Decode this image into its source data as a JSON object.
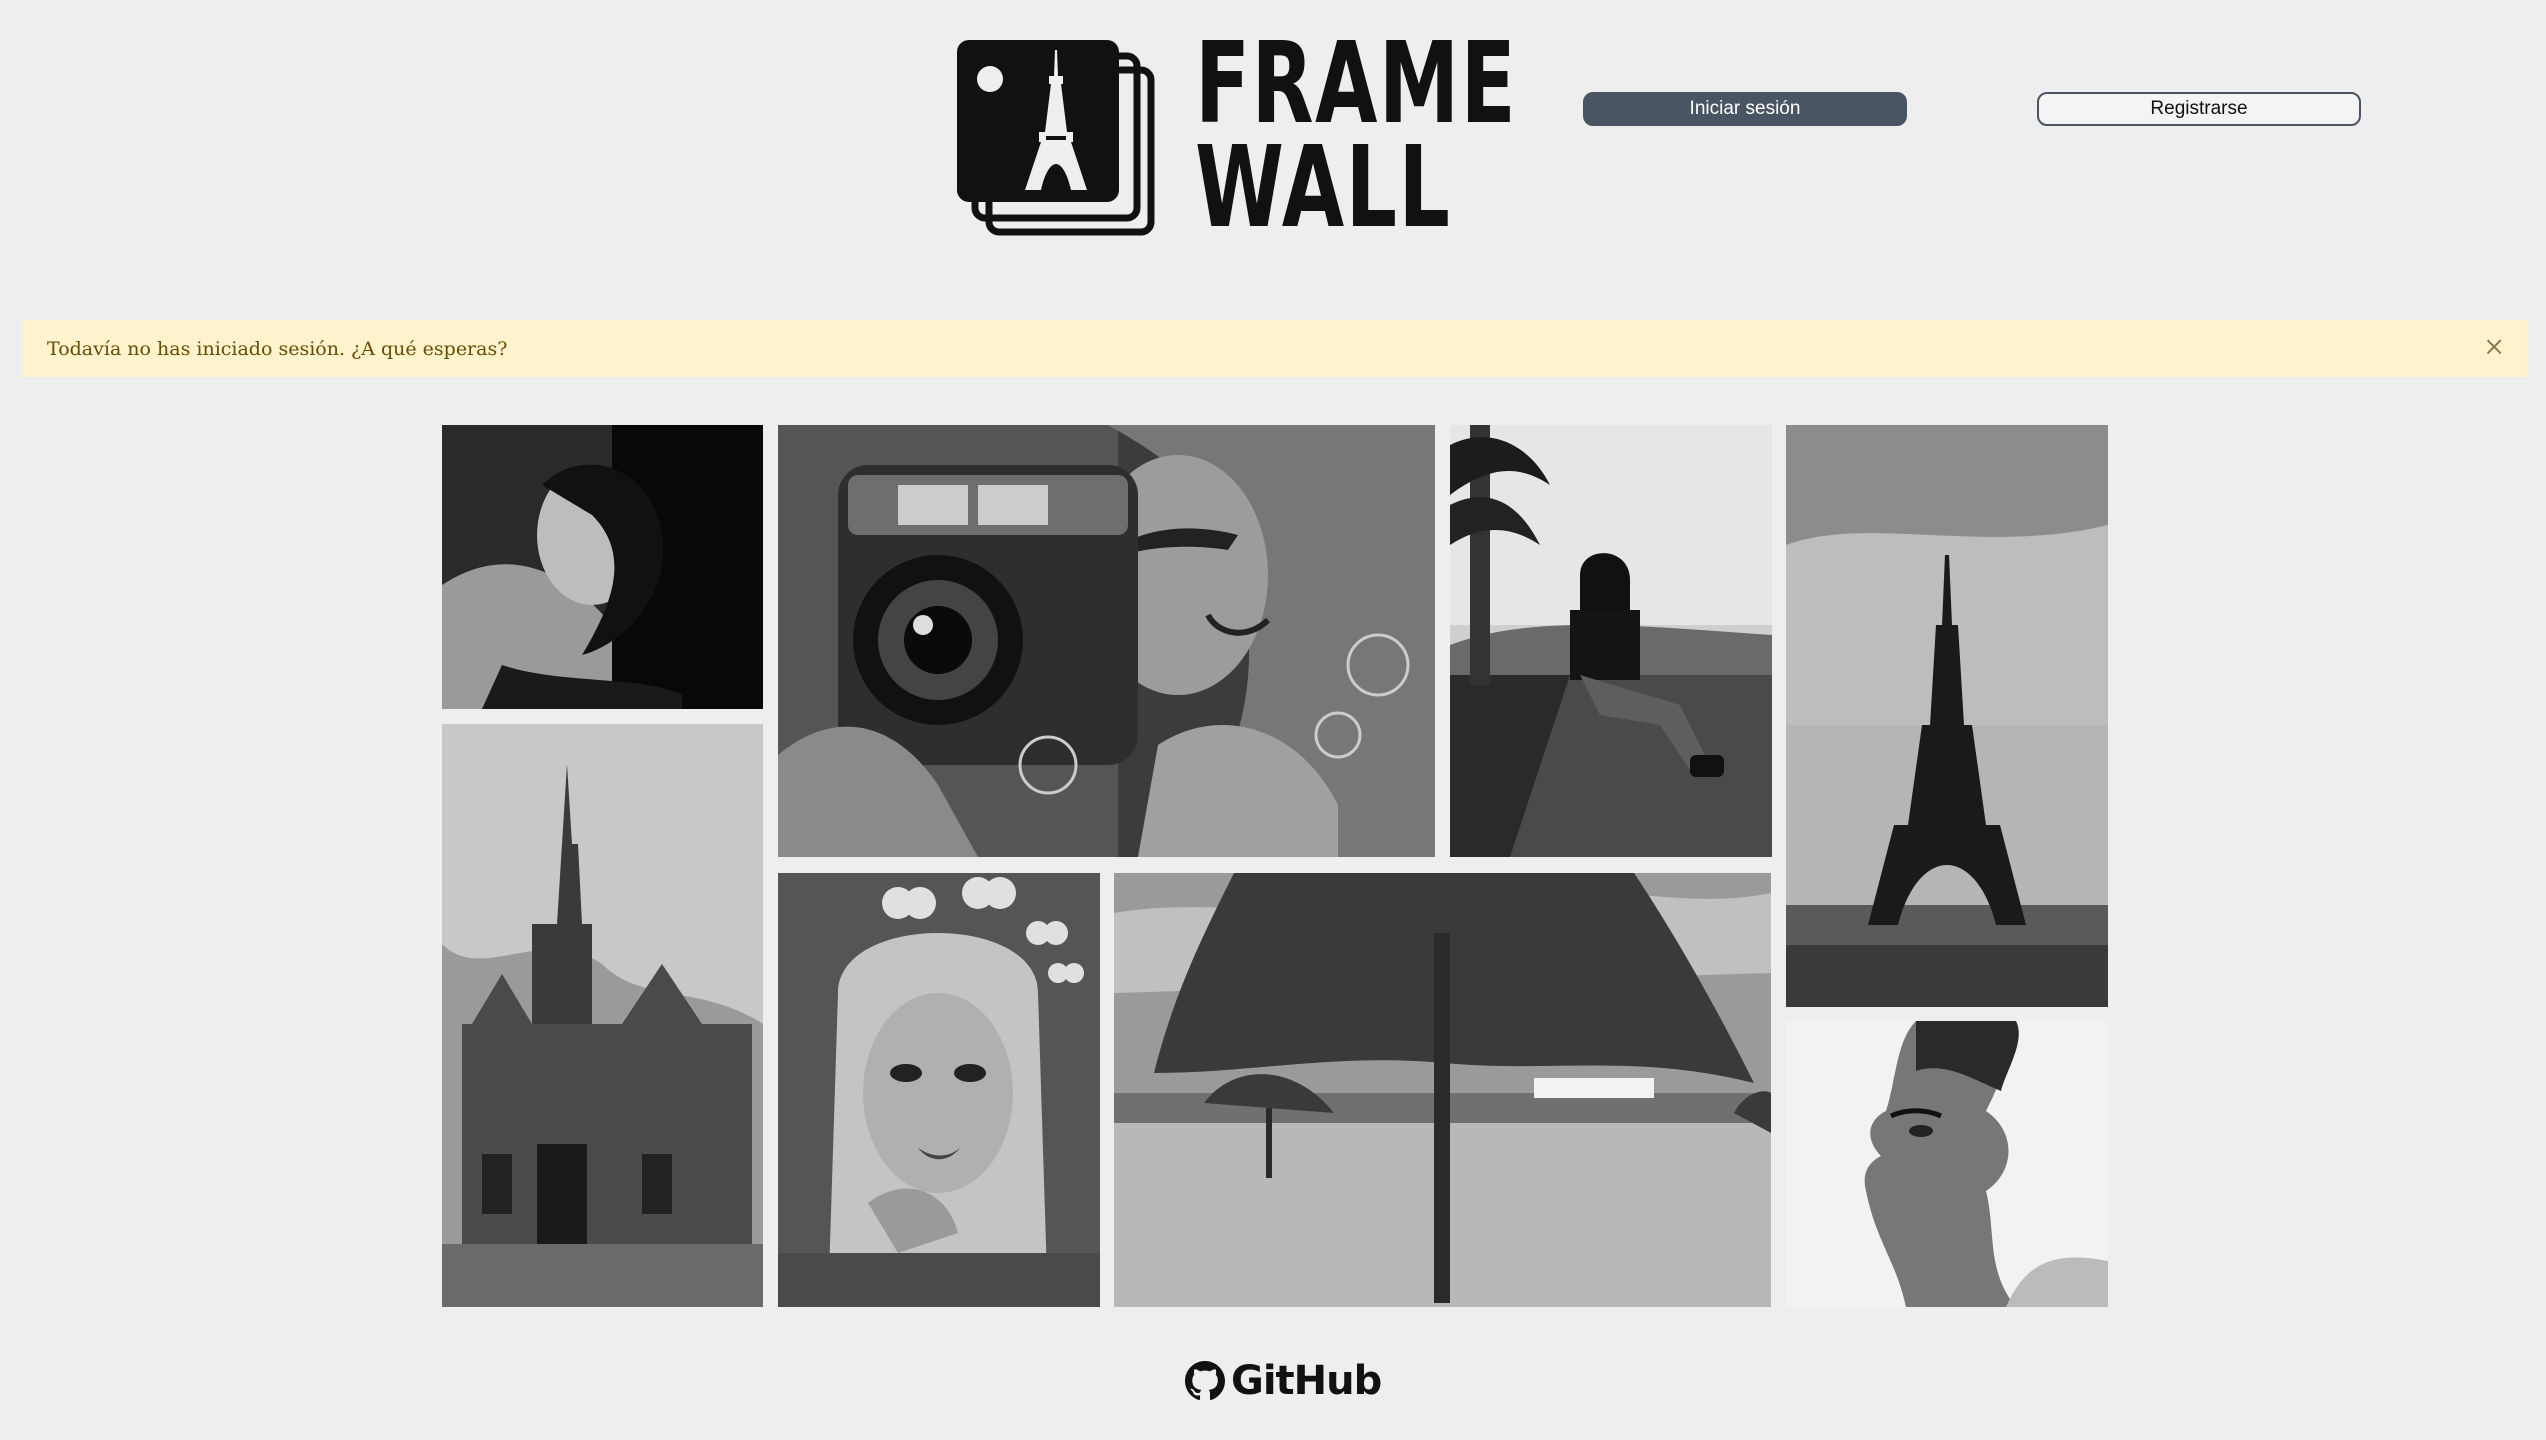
{
  "brand": {
    "line1": "FRAME",
    "line2": "WALL"
  },
  "header": {
    "login_label": "Iniciar sesión",
    "register_label": "Registrarse"
  },
  "alert": {
    "message": "Todavía no has iniciado sesión. ¿A qué esperas?",
    "close_glyph": "×"
  },
  "gallery": [
    {
      "name": "photo-woman-portrait",
      "subject": "woman reclining portrait"
    },
    {
      "name": "photo-camera-graffiti",
      "subject": "graffiti woman with camera"
    },
    {
      "name": "photo-girl-seated",
      "subject": "girl sitting by road with palm trees"
    },
    {
      "name": "photo-eiffel-tower",
      "subject": "Eiffel Tower"
    },
    {
      "name": "photo-cathedral",
      "subject": "gothic cathedral"
    },
    {
      "name": "photo-girl-hearts",
      "subject": "girl with hearts filter"
    },
    {
      "name": "photo-beach-umbrella",
      "subject": "beach thatched umbrella"
    },
    {
      "name": "photo-face-illusion",
      "subject": "face profile illusion"
    }
  ],
  "footer": {
    "label": "GitHub",
    "icon": "github-icon"
  },
  "colors": {
    "background": "#eeeeee",
    "button_dark": "#4a5563",
    "alert_bg": "#fff3cd",
    "alert_text": "#664d03"
  }
}
